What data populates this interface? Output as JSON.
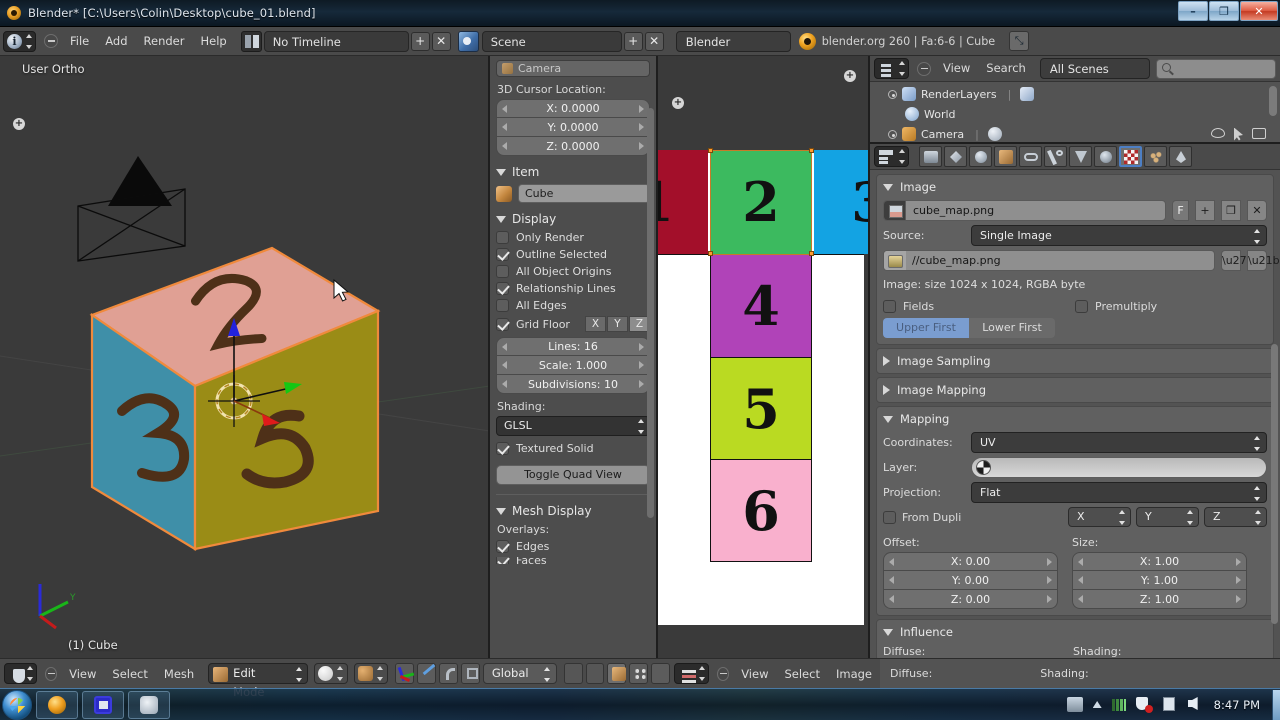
{
  "window": {
    "title": "Blender* [C:\\Users\\Colin\\Desktop\\cube_01.blend]",
    "minimize": "–",
    "maximize": "❐",
    "close": "✕"
  },
  "topbar": {
    "editor_icon": "info-editor-icon",
    "menus": [
      "File",
      "Add",
      "Render",
      "Help"
    ],
    "screen_layout": "No Timeline",
    "screen_add": "+",
    "screen_del": "✕",
    "scene_name": "Scene",
    "scene_add": "+",
    "scene_del": "✕",
    "render_engine": "Blender Render",
    "status": "blender.org 260 | Fa:6-6 | Cube",
    "fullscreen_label": "⤡"
  },
  "viewport": {
    "view_label": "User Ortho",
    "object_label": "(1) Cube",
    "faces": {
      "top_color": "#e0a094",
      "left_color": "#3f8fa8",
      "right_color": "#9a8c16",
      "outline_color": "#f08a3c"
    },
    "digits": {
      "top": "2",
      "left": "3",
      "right": "5"
    },
    "gizmo_axes": [
      "X",
      "Y",
      "Z"
    ]
  },
  "npanel": {
    "camera_item": "Camera",
    "cursor_label": "3D Cursor Location:",
    "cursor": {
      "x": "X: 0.0000",
      "y": "Y: 0.0000",
      "z": "Z: 0.0000"
    },
    "item": {
      "title": "Item",
      "name_value": "Cube"
    },
    "display": {
      "title": "Display",
      "checks": [
        {
          "label": "Only Render",
          "checked": false
        },
        {
          "label": "Outline Selected",
          "checked": true
        },
        {
          "label": "All Object Origins",
          "checked": false
        },
        {
          "label": "Relationship Lines",
          "checked": true
        },
        {
          "label": "All Edges",
          "checked": false
        }
      ],
      "grid_floor": {
        "label": "Grid Floor",
        "checked": true,
        "axes": [
          "X",
          "Y",
          "Z"
        ],
        "selected_axis": "Z"
      },
      "lines": "Lines: 16",
      "scale": "Scale: 1.000",
      "subdivisions": "Subdivisions: 10",
      "shading_label": "Shading:",
      "shading_value": "GLSL",
      "textured_solid": {
        "label": "Textured Solid",
        "checked": true
      },
      "toggle_quad_view": "Toggle Quad View"
    },
    "mesh_display": {
      "title": "Mesh Display",
      "overlays_label": "Overlays:",
      "checks": [
        {
          "label": "Edges",
          "checked": true
        },
        {
          "label": "Faces",
          "checked": true
        }
      ]
    }
  },
  "uv_editor": {
    "cells": [
      {
        "digit": "1",
        "color": "#a30f2a",
        "col": 0,
        "row": 0,
        "selected": false,
        "partial": true
      },
      {
        "digit": "2",
        "color": "#3cba5f",
        "col": 1,
        "row": 0,
        "selected": true,
        "partial": false
      },
      {
        "digit": "3",
        "color": "#13a3e3",
        "col": 2,
        "row": 0,
        "selected": false,
        "partial": true
      },
      {
        "digit": "4",
        "color": "#b043b8",
        "col": 1,
        "row": 1,
        "selected": false,
        "partial": false
      },
      {
        "digit": "5",
        "color": "#bada22",
        "col": 1,
        "row": 2,
        "selected": false,
        "partial": false
      },
      {
        "digit": "6",
        "color": "#f9b0cd",
        "col": 1,
        "row": 3,
        "selected": false,
        "partial": false
      }
    ]
  },
  "outliner": {
    "view_menu": "View",
    "search_menu": "Search",
    "scope": "All Scenes",
    "search_placeholder": "",
    "rows": [
      {
        "label": "RenderLayers",
        "icon": "renderlayers-icon",
        "expandable": true
      },
      {
        "label": "World",
        "icon": "world-icon",
        "expandable": false
      },
      {
        "label": "Camera",
        "icon": "camera-icon",
        "expandable": true
      }
    ]
  },
  "properties": {
    "tabs": [
      "render-tab",
      "scene-tab",
      "world-tab",
      "object-tab",
      "constraints-tab",
      "modifiers-tab",
      "data-tab",
      "material-tab",
      "texture-tab",
      "particles-tab",
      "physics-tab"
    ],
    "active_tab": "texture-tab",
    "image_panel": {
      "title": "Image",
      "datablock_name": "cube_map.png",
      "fake_user_label": "F",
      "add_label": "+",
      "open_label": "❐",
      "unlink_label": "✕",
      "source_label": "Source:",
      "source_value": "Single Image",
      "path_value": "//cube_map.png",
      "info": "Image: size 1024 x 1024, RGBA byte",
      "fields_check": {
        "label": "Fields",
        "checked": false
      },
      "premultiply_check": {
        "label": "Premultiply",
        "checked": false
      },
      "field_order": {
        "options": [
          "Upper First",
          "Lower First"
        ],
        "selected": "Upper First"
      }
    },
    "image_sampling": {
      "title": "Image Sampling",
      "open": false
    },
    "image_mapping": {
      "title": "Image Mapping",
      "open": false
    },
    "mapping_panel": {
      "title": "Mapping",
      "coordinates_label": "Coordinates:",
      "coordinates_value": "UV",
      "layer_label": "Layer:",
      "layer_value": "",
      "projection_label": "Projection:",
      "projection_value": "Flat",
      "from_dupli": {
        "label": "From Dupli",
        "checked": false
      },
      "axis_drops": [
        "X",
        "Y",
        "Z"
      ],
      "offset_label": "Offset:",
      "offset": {
        "x": "X: 0.00",
        "y": "Y: 0.00",
        "z": "Z: 0.00"
      },
      "size_label": "Size:",
      "size": {
        "x": "X: 1.00",
        "y": "Y: 1.00",
        "z": "Z: 1.00"
      }
    },
    "influence_panel": {
      "title": "Influence",
      "diffuse_label": "Diffuse:",
      "shading_label": "Shading:"
    }
  },
  "viewport_header": {
    "menus": [
      "View",
      "Select",
      "Mesh"
    ],
    "mode": "Edit Mode",
    "transform_orientation": "Global"
  },
  "uv_header": {
    "menus": [
      "View",
      "Select",
      "Image"
    ]
  },
  "taskbar": {
    "start_label": "start-orb",
    "items": [
      "blender-taskbar-item",
      "image-viewer-taskbar-item",
      "explorer-taskbar-item"
    ],
    "tray": [
      "keyboard-icon",
      "show-hidden-icon",
      "network-icon",
      "security-icon",
      "action-center-icon",
      "volume-icon"
    ],
    "clock": "8:47 PM"
  }
}
